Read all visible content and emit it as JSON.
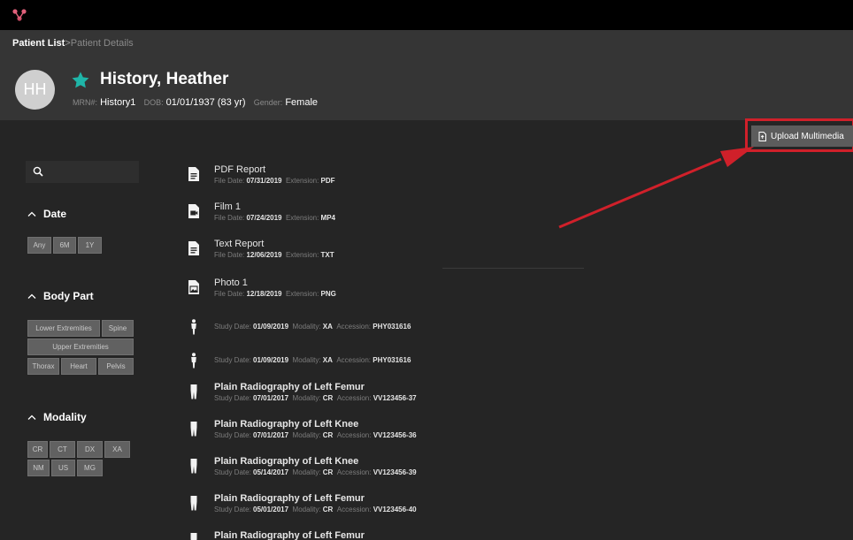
{
  "breadcrumb": {
    "root": "Patient List",
    "sep": ">",
    "current": "Patient Details"
  },
  "patient": {
    "initials": "HH",
    "name": "History, Heather",
    "mrn_label": "MRN#:",
    "mrn": "History1",
    "dob_label": "DOB:",
    "dob": "01/01/1937 (83 yr)",
    "gender_label": "Gender:",
    "gender": "Female"
  },
  "toolbar": {
    "upload_label": "Upload Multimedia"
  },
  "search": {
    "placeholder": ""
  },
  "filters": {
    "date": {
      "title": "Date",
      "options": [
        "Any",
        "6M",
        "1Y"
      ]
    },
    "body_part": {
      "title": "Body Part",
      "options": [
        "Lower Extremities",
        "Spine",
        "Upper Extremities",
        "Thorax",
        "Heart",
        "Pelvis"
      ]
    },
    "modality": {
      "title": "Modality",
      "options": [
        "CR",
        "CT",
        "DX",
        "XA",
        "NM",
        "US",
        "MG"
      ]
    }
  },
  "items": [
    {
      "icon": "document-icon",
      "title": "PDF Report",
      "fields": [
        [
          "File Date:",
          "07/31/2019"
        ],
        [
          "Extension:",
          "PDF"
        ]
      ]
    },
    {
      "icon": "film-file-icon",
      "title": "Film 1",
      "fields": [
        [
          "File Date:",
          "07/24/2019"
        ],
        [
          "Extension:",
          "MP4"
        ]
      ]
    },
    {
      "icon": "document-icon",
      "title": "Text Report",
      "fields": [
        [
          "File Date:",
          "12/06/2019"
        ],
        [
          "Extension:",
          "TXT"
        ]
      ]
    },
    {
      "icon": "image-file-icon",
      "title": "Photo 1",
      "fields": [
        [
          "File Date:",
          "12/18/2019"
        ],
        [
          "Extension:",
          "PNG"
        ]
      ]
    },
    {
      "icon": "person-icon",
      "title": "",
      "fields": [
        [
          "Study Date:",
          "01/09/2019"
        ],
        [
          "Modality:",
          "XA"
        ],
        [
          "Accession:",
          "PHY031616"
        ]
      ]
    },
    {
      "icon": "person-icon",
      "title": "",
      "fields": [
        [
          "Study Date:",
          "01/09/2019"
        ],
        [
          "Modality:",
          "XA"
        ],
        [
          "Accession:",
          "PHY031616"
        ]
      ]
    },
    {
      "icon": "leg-icon",
      "title": "Plain Radiography of Left Femur",
      "fields": [
        [
          "Study Date:",
          "07/01/2017"
        ],
        [
          "Modality:",
          "CR"
        ],
        [
          "Accession:",
          "VV123456-37"
        ]
      ]
    },
    {
      "icon": "leg-icon",
      "title": "Plain Radiography of Left Knee",
      "fields": [
        [
          "Study Date:",
          "07/01/2017"
        ],
        [
          "Modality:",
          "CR"
        ],
        [
          "Accession:",
          "VV123456-36"
        ]
      ]
    },
    {
      "icon": "leg-icon",
      "title": "Plain Radiography of Left Knee",
      "fields": [
        [
          "Study Date:",
          "05/14/2017"
        ],
        [
          "Modality:",
          "CR"
        ],
        [
          "Accession:",
          "VV123456-39"
        ]
      ]
    },
    {
      "icon": "leg-icon",
      "title": "Plain Radiography of Left Femur",
      "fields": [
        [
          "Study Date:",
          "05/01/2017"
        ],
        [
          "Modality:",
          "CR"
        ],
        [
          "Accession:",
          "VV123456-40"
        ]
      ]
    },
    {
      "icon": "leg-icon",
      "title": "Plain Radiography of Left Femur",
      "fields": []
    }
  ],
  "colors": {
    "accent_star": "#1fb5a8",
    "annotation_red": "#d0202a",
    "logo": "#e0607a"
  }
}
